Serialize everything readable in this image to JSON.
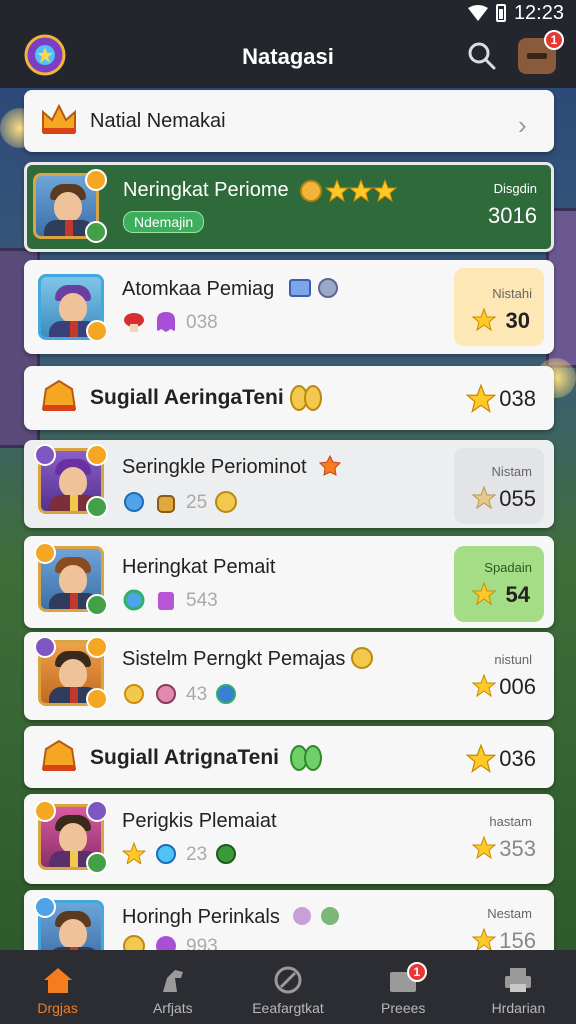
{
  "status": {
    "time": "12:23"
  },
  "appbar": {
    "title": "Natagasi",
    "inbox_badge": "1"
  },
  "cards": [
    {
      "kind": "header",
      "title": "Natial Nemakai"
    },
    {
      "kind": "player-green",
      "title": "Neringkat Periome",
      "chip": "Ndemajin",
      "right_label": "Disgdin",
      "right_value": "3016"
    },
    {
      "kind": "player",
      "title": "Atomkaa Pemiag",
      "sub": "038",
      "right_label": "Nistahi",
      "right_value": "30",
      "box": "#fde7b5"
    },
    {
      "kind": "section",
      "title": "Sugiall AeringaTeni",
      "right_value": "038"
    },
    {
      "kind": "player",
      "title": "Seringkle Periominot",
      "sub": "25",
      "right_label": "Nistam",
      "right_value": "055",
      "box": "#e8e9ec"
    },
    {
      "kind": "player",
      "title": "Heringkat Pemait",
      "sub": "543",
      "right_label": "Spadain",
      "right_value": "54",
      "box": "#a5dc86"
    },
    {
      "kind": "player",
      "title": "Sistelm Perngkt Pemajas",
      "sub": "43",
      "right_label": "nistunl",
      "right_value": "006"
    },
    {
      "kind": "section",
      "title": "Sugiall AtrignaTeni",
      "right_value": "036"
    },
    {
      "kind": "player",
      "title": "Perigkis Plemaiat",
      "sub": "23",
      "right_label": "hastam",
      "right_value": "353"
    },
    {
      "kind": "player",
      "title": "Horingh Perinkals",
      "sub": "993",
      "right_label": "Nestam",
      "right_value": "156"
    }
  ],
  "nav": [
    {
      "label": "Drgjas",
      "active": true
    },
    {
      "label": "Arfjats",
      "active": false
    },
    {
      "label": "Eeafargtkat",
      "active": false
    },
    {
      "label": "Preees",
      "active": false,
      "badge": "1"
    },
    {
      "label": "Hrdarian",
      "active": false
    }
  ],
  "colors": {
    "accent": "#f57c1f",
    "green_card": "#2f6b3a",
    "badge": "#e53935"
  }
}
